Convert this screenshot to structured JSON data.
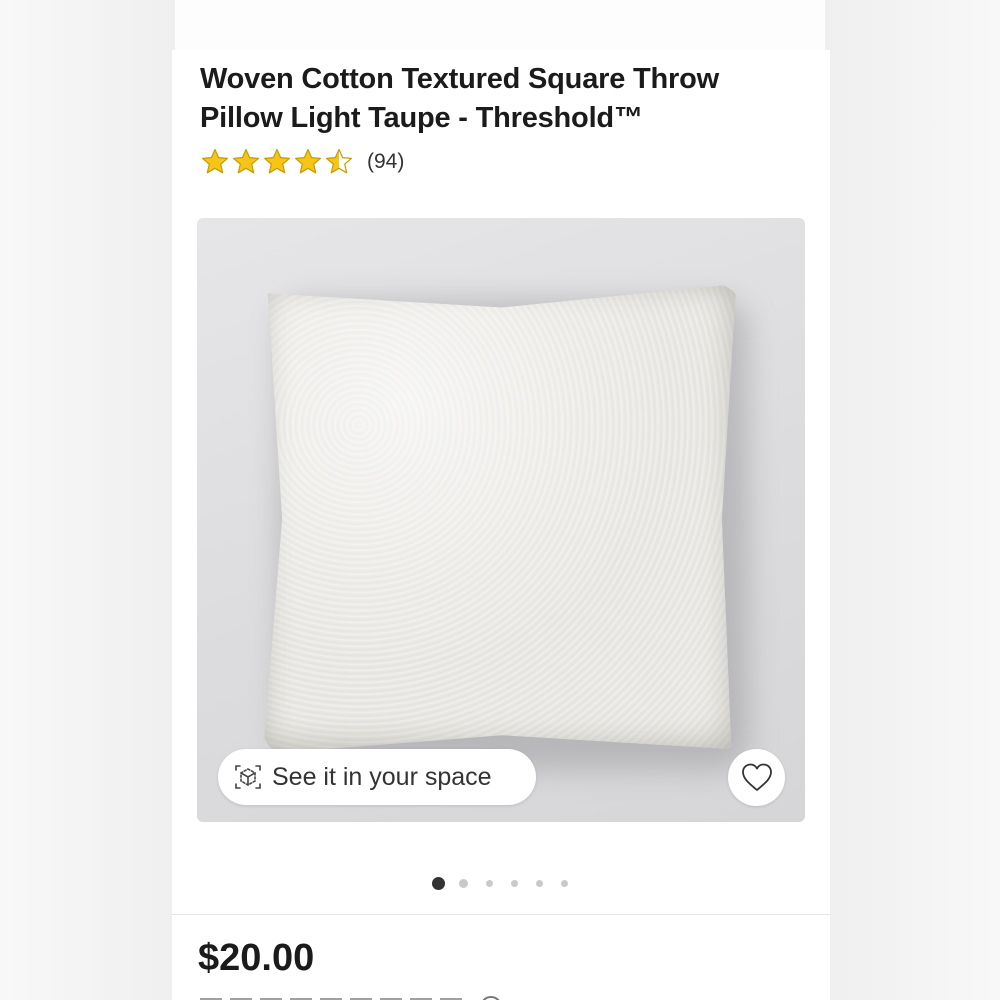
{
  "product": {
    "title_line1": "Woven Cotton Textured Square Throw",
    "title_line2": "Pillow Light Taupe - Threshold™",
    "rating_value": 4.5,
    "rating_max": 5,
    "review_count": "(94)",
    "price": "$20.00"
  },
  "image_actions": {
    "ar_label": "See it in your space",
    "ar_icon": "ar-cube-icon",
    "favorite_icon": "heart-icon"
  },
  "carousel": {
    "total_slides": 6,
    "active_index": 0
  },
  "colors": {
    "star": "#f5c518",
    "text": "#1b1b1b",
    "active_dot": "#333333",
    "inactive_dot": "#c9c9c9"
  }
}
